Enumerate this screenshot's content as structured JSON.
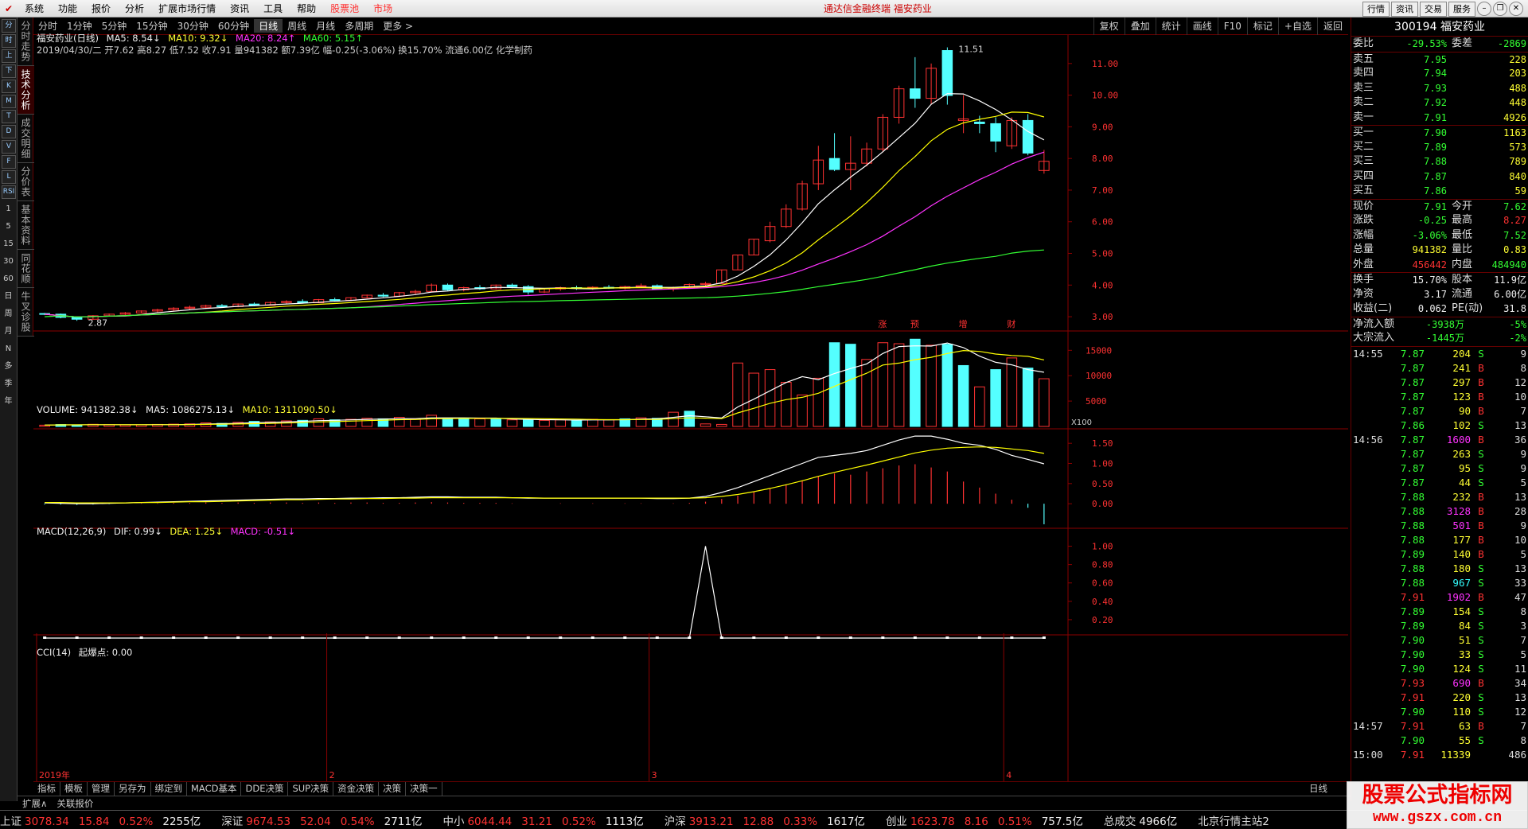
{
  "menu": {
    "items": [
      "系统",
      "功能",
      "报价",
      "分析",
      "扩展市场行情",
      "资讯",
      "工具",
      "帮助"
    ],
    "stockpool": "股票池",
    "market": "市场",
    "center_title": "通达信金融终端 福安药业",
    "right_buttons": [
      "行情",
      "资讯",
      "交易",
      "服务"
    ]
  },
  "left_toolbar": {
    "icons": [
      "分",
      "时",
      "上",
      "下",
      "K",
      "M",
      "T",
      "D",
      "V",
      "F",
      "L",
      "RSI"
    ],
    "labels": [
      "1",
      "5",
      "15",
      "30",
      "60",
      "日",
      "周",
      "月",
      "N",
      "多",
      "季",
      "年"
    ]
  },
  "side_tabs": [
    "分时走势",
    "技术分析",
    "成交明细",
    "分价表",
    "基本资料",
    "同花顺",
    "牛叉诊股"
  ],
  "periods": [
    "分时",
    "1分钟",
    "5分钟",
    "15分钟",
    "30分钟",
    "60分钟",
    "日线",
    "周线",
    "月线",
    "多周期",
    "更多 >"
  ],
  "period_right": [
    "复权",
    "叠加",
    "统计",
    "画线",
    "F10",
    "标记",
    "+自选",
    "返回"
  ],
  "kline_legend": {
    "name": "福安药业(日线)",
    "ma5": "MA5: 8.54↓",
    "ma10": "MA10: 9.32↓",
    "ma20": "MA20: 8.24↑",
    "ma60": "MA60: 5.15↑",
    "info": "2019/04/30/二 开7.62 高8.27 低7.52 收7.91 量941382 额7.39亿 幅-0.25(-3.06%) 换15.70% 流通6.00亿 化学制药"
  },
  "volume_legend": {
    "vol": "VOLUME: 941382.38↓",
    "ma5": "MA5: 1086275.13↓",
    "ma10": "MA10: 1311090.50↓"
  },
  "macd_legend": {
    "name": "MACD(12,26,9)",
    "dif": "DIF: 0.99↓",
    "dea": "DEA: 1.25↓",
    "macd": "MACD: -0.51↓"
  },
  "cci_legend": {
    "name": "CCI(14)",
    "qbd": "起爆点: 0.00"
  },
  "annotations": {
    "high": "11.51",
    "low": "2.87",
    "events": [
      "涨",
      "预",
      "增",
      "财"
    ],
    "x100": "X100"
  },
  "price_axis": [
    "11.00",
    "10.00",
    "9.00",
    "8.00",
    "7.00",
    "6.00",
    "5.00",
    "4.00",
    "3.00"
  ],
  "vol_axis": [
    "15000",
    "10000",
    "5000"
  ],
  "macd_axis": [
    "1.50",
    "1.00",
    "0.50",
    "0.00"
  ],
  "cci_axis": [
    "1.00",
    "0.80",
    "0.60",
    "0.40",
    "0.20"
  ],
  "date_axis": [
    "2019年",
    "2",
    "3",
    "4"
  ],
  "colors": {
    "up": "#ff3232",
    "down": "#54ffff",
    "ma5": "#ffffff",
    "ma10": "#ffff00",
    "ma20": "#ff33ff",
    "ma60": "#33ff33",
    "grid": "#8b0000"
  },
  "kline": [
    [
      3.1,
      3.12,
      3.05,
      3.08
    ],
    [
      3.08,
      3.1,
      2.95,
      2.98
    ],
    [
      2.98,
      3.0,
      2.87,
      2.92
    ],
    [
      2.92,
      3.05,
      2.9,
      3.03
    ],
    [
      3.03,
      3.1,
      3.0,
      3.08
    ],
    [
      3.08,
      3.15,
      3.05,
      3.12
    ],
    [
      3.12,
      3.2,
      3.1,
      3.18
    ],
    [
      3.18,
      3.25,
      3.12,
      3.22
    ],
    [
      3.22,
      3.3,
      3.18,
      3.27
    ],
    [
      3.27,
      3.35,
      3.22,
      3.3
    ],
    [
      3.3,
      3.38,
      3.25,
      3.35
    ],
    [
      3.35,
      3.4,
      3.28,
      3.32
    ],
    [
      3.32,
      3.42,
      3.3,
      3.4
    ],
    [
      3.4,
      3.45,
      3.33,
      3.36
    ],
    [
      3.36,
      3.48,
      3.35,
      3.45
    ],
    [
      3.45,
      3.52,
      3.4,
      3.48
    ],
    [
      3.48,
      3.55,
      3.42,
      3.44
    ],
    [
      3.44,
      3.56,
      3.43,
      3.54
    ],
    [
      3.54,
      3.6,
      3.48,
      3.52
    ],
    [
      3.52,
      3.62,
      3.5,
      3.6
    ],
    [
      3.6,
      3.7,
      3.58,
      3.68
    ],
    [
      3.68,
      3.75,
      3.62,
      3.65
    ],
    [
      3.65,
      3.78,
      3.64,
      3.76
    ],
    [
      3.76,
      3.85,
      3.7,
      3.8
    ],
    [
      3.8,
      4.05,
      3.78,
      4.0
    ],
    [
      4.0,
      4.05,
      3.82,
      3.85
    ],
    [
      3.85,
      3.95,
      3.8,
      3.92
    ],
    [
      3.92,
      4.0,
      3.85,
      3.88
    ],
    [
      3.88,
      4.02,
      3.86,
      4.0
    ],
    [
      4.0,
      4.05,
      3.9,
      3.95
    ],
    [
      3.95,
      4.0,
      3.7,
      3.78
    ],
    [
      3.78,
      3.9,
      3.75,
      3.88
    ],
    [
      3.88,
      3.95,
      3.82,
      3.92
    ],
    [
      3.92,
      3.98,
      3.85,
      3.9
    ],
    [
      3.9,
      3.96,
      3.85,
      3.93
    ],
    [
      3.93,
      4.0,
      3.88,
      3.9
    ],
    [
      3.9,
      3.98,
      3.86,
      3.95
    ],
    [
      3.95,
      4.05,
      3.92,
      3.98
    ],
    [
      3.98,
      4.02,
      3.85,
      3.88
    ],
    [
      3.88,
      3.95,
      3.8,
      3.92
    ],
    [
      3.92,
      4.05,
      3.9,
      4.02
    ],
    [
      4.02,
      4.1,
      3.98,
      4.05
    ],
    [
      4.05,
      4.48,
      4.05,
      4.48
    ],
    [
      4.48,
      4.95,
      4.48,
      4.95
    ],
    [
      4.95,
      5.45,
      4.95,
      5.45
    ],
    [
      5.4,
      6.0,
      5.35,
      5.85
    ],
    [
      5.85,
      6.55,
      5.8,
      6.4
    ],
    [
      6.4,
      7.3,
      6.35,
      7.2
    ],
    [
      7.2,
      8.4,
      7.0,
      7.95
    ],
    [
      8.0,
      8.8,
      7.6,
      7.65
    ],
    [
      7.65,
      8.7,
      7.0,
      7.85
    ],
    [
      7.85,
      8.5,
      7.75,
      8.3
    ],
    [
      8.3,
      9.4,
      8.2,
      9.3
    ],
    [
      9.3,
      10.3,
      9.1,
      10.2
    ],
    [
      10.2,
      11.2,
      9.6,
      9.9
    ],
    [
      9.9,
      11.0,
      9.7,
      10.85
    ],
    [
      11.41,
      11.51,
      9.7,
      9.99
    ],
    [
      9.2,
      10.0,
      8.8,
      9.25
    ],
    [
      9.15,
      9.35,
      8.8,
      9.1
    ],
    [
      9.1,
      9.3,
      8.2,
      8.55
    ],
    [
      8.4,
      9.3,
      8.3,
      9.2
    ],
    [
      9.2,
      9.4,
      8.1,
      8.17
    ],
    [
      7.62,
      8.27,
      7.52,
      7.91
    ]
  ],
  "volume": [
    [
      250,
      1
    ],
    [
      380,
      0
    ],
    [
      300,
      0
    ],
    [
      420,
      1
    ],
    [
      350,
      1
    ],
    [
      300,
      1
    ],
    [
      320,
      1
    ],
    [
      400,
      1
    ],
    [
      450,
      1
    ],
    [
      500,
      1
    ],
    [
      700,
      1
    ],
    [
      600,
      0
    ],
    [
      800,
      1
    ],
    [
      1000,
      0
    ],
    [
      900,
      1
    ],
    [
      1100,
      1
    ],
    [
      1200,
      0
    ],
    [
      1500,
      1
    ],
    [
      1300,
      0
    ],
    [
      1400,
      1
    ],
    [
      1600,
      1
    ],
    [
      1500,
      0
    ],
    [
      1800,
      1
    ],
    [
      1400,
      1
    ],
    [
      2200,
      1
    ],
    [
      1600,
      0
    ],
    [
      1500,
      0
    ],
    [
      1500,
      1
    ],
    [
      1400,
      0
    ],
    [
      1300,
      1
    ],
    [
      1300,
      0
    ],
    [
      1200,
      1
    ],
    [
      1300,
      1
    ],
    [
      1200,
      0
    ],
    [
      1400,
      1
    ],
    [
      1300,
      1
    ],
    [
      1500,
      0
    ],
    [
      1700,
      1
    ],
    [
      1600,
      0
    ],
    [
      2800,
      1
    ],
    [
      3000,
      0
    ],
    [
      500,
      1
    ],
    [
      400,
      1
    ],
    [
      12500,
      1
    ],
    [
      10500,
      1
    ],
    [
      11200,
      1
    ],
    [
      8700,
      1
    ],
    [
      6200,
      1
    ],
    [
      9500,
      1
    ],
    [
      16500,
      0
    ],
    [
      16200,
      0
    ],
    [
      13200,
      1
    ],
    [
      16500,
      1
    ],
    [
      16300,
      1
    ],
    [
      17200,
      0
    ],
    [
      16000,
      1
    ],
    [
      16200,
      0
    ],
    [
      12000,
      0
    ],
    [
      7800,
      1
    ],
    [
      11200,
      0
    ],
    [
      13500,
      1
    ],
    [
      11500,
      0
    ],
    [
      9400,
      1
    ]
  ],
  "macd_bars": [
    -0.02,
    -0.02,
    -0.03,
    -0.02,
    -0.01,
    0.0,
    0.01,
    0.01,
    0.02,
    0.02,
    0.03,
    0.02,
    0.03,
    0.02,
    0.03,
    0.03,
    0.02,
    0.03,
    0.02,
    0.03,
    0.03,
    0.02,
    0.02,
    0.03,
    0.04,
    0.03,
    0.02,
    0.02,
    0.02,
    0.01,
    0.0,
    0.0,
    0.01,
    0.0,
    0.01,
    0.0,
    0.01,
    0.01,
    0.0,
    0.01,
    0.02,
    0.05,
    0.12,
    0.2,
    0.3,
    0.38,
    0.48,
    0.58,
    0.68,
    0.75,
    0.72,
    0.8,
    0.88,
    0.95,
    0.98,
    0.9,
    0.8,
    0.55,
    0.4,
    0.25,
    0.1,
    -0.1,
    -0.51
  ],
  "macd_dif": [
    0.02,
    0.01,
    0.0,
    0.0,
    0.01,
    0.02,
    0.03,
    0.04,
    0.05,
    0.06,
    0.07,
    0.08,
    0.09,
    0.1,
    0.11,
    0.12,
    0.12,
    0.13,
    0.13,
    0.14,
    0.14,
    0.15,
    0.15,
    0.16,
    0.17,
    0.17,
    0.16,
    0.16,
    0.16,
    0.15,
    0.14,
    0.14,
    0.14,
    0.14,
    0.14,
    0.14,
    0.14,
    0.14,
    0.13,
    0.13,
    0.14,
    0.18,
    0.28,
    0.4,
    0.55,
    0.7,
    0.85,
    1.0,
    1.15,
    1.2,
    1.25,
    1.32,
    1.45,
    1.58,
    1.68,
    1.68,
    1.6,
    1.5,
    1.45,
    1.35,
    1.2,
    1.1,
    0.99
  ],
  "macd_dea": [
    0.03,
    0.03,
    0.02,
    0.02,
    0.02,
    0.02,
    0.03,
    0.03,
    0.04,
    0.05,
    0.05,
    0.06,
    0.07,
    0.08,
    0.09,
    0.1,
    0.1,
    0.11,
    0.12,
    0.12,
    0.13,
    0.13,
    0.14,
    0.14,
    0.15,
    0.15,
    0.15,
    0.15,
    0.15,
    0.15,
    0.15,
    0.14,
    0.14,
    0.14,
    0.14,
    0.14,
    0.14,
    0.14,
    0.14,
    0.14,
    0.14,
    0.15,
    0.18,
    0.23,
    0.3,
    0.38,
    0.47,
    0.57,
    0.68,
    0.78,
    0.87,
    0.96,
    1.06,
    1.16,
    1.26,
    1.33,
    1.38,
    1.4,
    1.41,
    1.4,
    1.36,
    1.32,
    1.25
  ],
  "cci_spike_index": 41,
  "cci_value": 1.0,
  "quote": {
    "code_name": "300194 福安药业",
    "weibi_label": "委比",
    "weibi": "-29.53%",
    "weicha_label": "委差",
    "weicha": "-2869",
    "asks": [
      {
        "label": "卖五",
        "price": "7.95",
        "vol": "228"
      },
      {
        "label": "卖四",
        "price": "7.94",
        "vol": "203"
      },
      {
        "label": "卖三",
        "price": "7.93",
        "vol": "488"
      },
      {
        "label": "卖二",
        "price": "7.92",
        "vol": "448"
      },
      {
        "label": "卖一",
        "price": "7.91",
        "vol": "4926"
      }
    ],
    "bids": [
      {
        "label": "买一",
        "price": "7.90",
        "vol": "1163"
      },
      {
        "label": "买二",
        "price": "7.89",
        "vol": "573"
      },
      {
        "label": "买三",
        "price": "7.88",
        "vol": "789"
      },
      {
        "label": "买四",
        "price": "7.87",
        "vol": "840"
      },
      {
        "label": "买五",
        "price": "7.86",
        "vol": "59"
      }
    ],
    "stats": [
      {
        "l1": "现价",
        "v1": "7.91",
        "c1": "grn",
        "l2": "今开",
        "v2": "7.62",
        "c2": "grn"
      },
      {
        "l1": "涨跌",
        "v1": "-0.25",
        "c1": "grn",
        "l2": "最高",
        "v2": "8.27",
        "c2": "red"
      },
      {
        "l1": "涨幅",
        "v1": "-3.06%",
        "c1": "grn",
        "l2": "最低",
        "v2": "7.52",
        "c2": "grn"
      },
      {
        "l1": "总量",
        "v1": "941382",
        "c1": "yel",
        "l2": "量比",
        "v2": "0.83",
        "c2": "yel"
      },
      {
        "l1": "外盘",
        "v1": "456442",
        "c1": "red",
        "l2": "内盘",
        "v2": "484940",
        "c2": "grn"
      }
    ],
    "stats2": [
      {
        "l1": "换手",
        "v1": "15.70%",
        "c1": "wht",
        "l2": "股本",
        "v2": "11.9亿",
        "c2": "wht"
      },
      {
        "l1": "净资",
        "v1": "3.17",
        "c1": "wht",
        "l2": "流通",
        "v2": "6.00亿",
        "c2": "wht"
      },
      {
        "l1": "收益(二)",
        "v1": "0.062",
        "c1": "wht",
        "l2": "PE(动)",
        "v2": "31.8",
        "c2": "wht"
      }
    ],
    "flows": [
      {
        "label": "净流入额",
        "val": "-3938万",
        "pct": "-5%"
      },
      {
        "label": "大宗流入",
        "val": "-1445万",
        "pct": "-2%"
      }
    ],
    "ticks": [
      {
        "t": "14:55",
        "p": "7.87",
        "v": "204",
        "bs": "S",
        "n": "9"
      },
      {
        "t": "",
        "p": "7.87",
        "v": "241",
        "bs": "B",
        "n": "8"
      },
      {
        "t": "",
        "p": "7.87",
        "v": "297",
        "bs": "B",
        "n": "12"
      },
      {
        "t": "",
        "p": "7.87",
        "v": "123",
        "bs": "B",
        "n": "10"
      },
      {
        "t": "",
        "p": "7.87",
        "v": "90",
        "bs": "B",
        "n": "7"
      },
      {
        "t": "",
        "p": "7.86",
        "v": "102",
        "bs": "S",
        "n": "13"
      },
      {
        "t": "14:56",
        "p": "7.87",
        "v": "1600",
        "bs": "B",
        "n": "36"
      },
      {
        "t": "",
        "p": "7.87",
        "v": "263",
        "bs": "S",
        "n": "9"
      },
      {
        "t": "",
        "p": "7.87",
        "v": "95",
        "bs": "S",
        "n": "9"
      },
      {
        "t": "",
        "p": "7.87",
        "v": "44",
        "bs": "S",
        "n": "5"
      },
      {
        "t": "",
        "p": "7.88",
        "v": "232",
        "bs": "B",
        "n": "13"
      },
      {
        "t": "",
        "p": "7.88",
        "v": "3128",
        "bs": "B",
        "n": "28"
      },
      {
        "t": "",
        "p": "7.88",
        "v": "501",
        "bs": "B",
        "n": "9"
      },
      {
        "t": "",
        "p": "7.88",
        "v": "177",
        "bs": "B",
        "n": "10"
      },
      {
        "t": "",
        "p": "7.89",
        "v": "140",
        "bs": "B",
        "n": "5"
      },
      {
        "t": "",
        "p": "7.88",
        "v": "180",
        "bs": "S",
        "n": "13"
      },
      {
        "t": "",
        "p": "7.88",
        "v": "967",
        "bs": "S",
        "n": "33"
      },
      {
        "t": "",
        "p": "7.91",
        "v": "1902",
        "bs": "B",
        "n": "47"
      },
      {
        "t": "",
        "p": "7.89",
        "v": "154",
        "bs": "S",
        "n": "8"
      },
      {
        "t": "",
        "p": "7.89",
        "v": "84",
        "bs": "S",
        "n": "3"
      },
      {
        "t": "",
        "p": "7.90",
        "v": "51",
        "bs": "S",
        "n": "7"
      },
      {
        "t": "",
        "p": "7.90",
        "v": "33",
        "bs": "S",
        "n": "5"
      },
      {
        "t": "",
        "p": "7.90",
        "v": "124",
        "bs": "S",
        "n": "11"
      },
      {
        "t": "",
        "p": "7.93",
        "v": "690",
        "bs": "B",
        "n": "34"
      },
      {
        "t": "",
        "p": "7.91",
        "v": "220",
        "bs": "S",
        "n": "13"
      },
      {
        "t": "",
        "p": "7.90",
        "v": "110",
        "bs": "S",
        "n": "12"
      },
      {
        "t": "14:57",
        "p": "7.91",
        "v": "63",
        "bs": "B",
        "n": "7"
      },
      {
        "t": "",
        "p": "7.90",
        "v": "55",
        "bs": "S",
        "n": "8"
      },
      {
        "t": "15:00",
        "p": "7.91",
        "v": "11339",
        "bs": "",
        "n": "486"
      }
    ]
  },
  "bottom_tabs": [
    "指标",
    "模板",
    "管理",
    "另存为",
    "绑定到",
    "MACD基本",
    "DDE决策",
    "SUP决策",
    "资金决策",
    "决策",
    "决策一"
  ],
  "bottom_right": "日线",
  "status_left": [
    "扩展∧",
    "关联报价"
  ],
  "indices": [
    {
      "name": "上证",
      "val": "3078.34",
      "chg": "15.84",
      "pct": "0.52%",
      "amt": "2255亿"
    },
    {
      "name": "深证",
      "val": "9674.53",
      "chg": "52.04",
      "pct": "0.54%",
      "amt": "2711亿"
    },
    {
      "name": "中小",
      "val": "6044.44",
      "chg": "31.21",
      "pct": "0.52%",
      "amt": "1113亿"
    },
    {
      "name": "沪深",
      "val": "3913.21",
      "chg": "12.88",
      "pct": "0.33%",
      "amt": "1617亿"
    },
    {
      "name": "创业",
      "val": "1623.78",
      "chg": "8.16",
      "pct": "0.51%",
      "amt": "757.5亿"
    }
  ],
  "total_label": "总成交",
  "total_val": "4966亿",
  "server": "北京行情主站2",
  "watermark": {
    "line1": "股票公式指标网",
    "line2": "www.gszx.com.cn"
  }
}
